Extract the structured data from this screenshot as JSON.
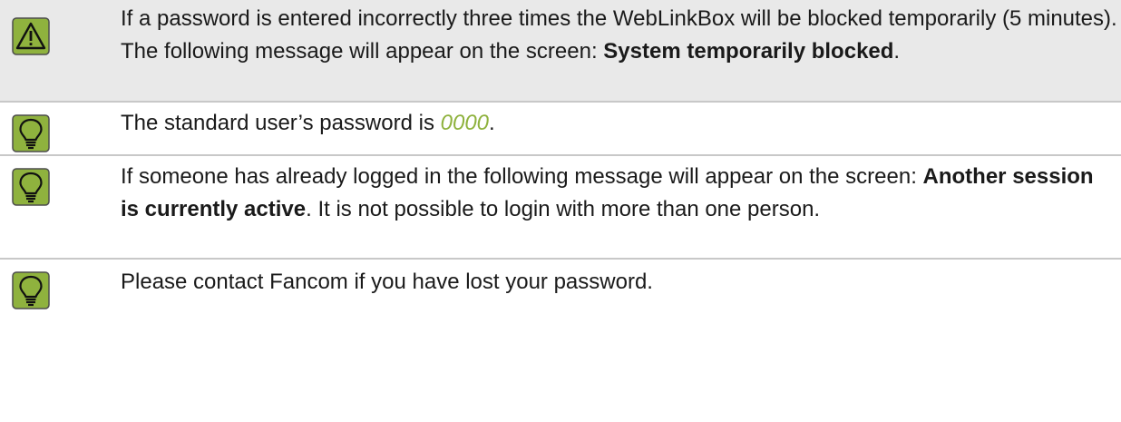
{
  "notes": [
    {
      "type": "warning",
      "icon": "warning-icon",
      "text_before": "If a password is entered incorrectly three times the WebLinkBox will be blocked temporarily (5 minutes). The following message will appear on the screen: ",
      "text_bold": "System temporarily blocked",
      "text_after": "."
    },
    {
      "type": "tip",
      "icon": "lightbulb-icon",
      "text_before": "The standard user’s password is ",
      "text_highlight": "0000",
      "text_after": "."
    },
    {
      "type": "tip",
      "icon": "lightbulb-icon",
      "text_before": "If someone has already logged in the following message will appear on the screen: ",
      "text_bold": "Another session is currently active",
      "text_after": ". It is not possible to login with more than one person."
    },
    {
      "type": "tip",
      "icon": "lightbulb-icon",
      "text": "Please contact Fancom if you have lost your password."
    }
  ],
  "colors": {
    "icon_green": "#8fb23e",
    "icon_border": "#4d4d4d",
    "highlight": "#8fb23e",
    "warning_row_bg": "#e9e9e9",
    "divider": "#c8c8c8"
  }
}
